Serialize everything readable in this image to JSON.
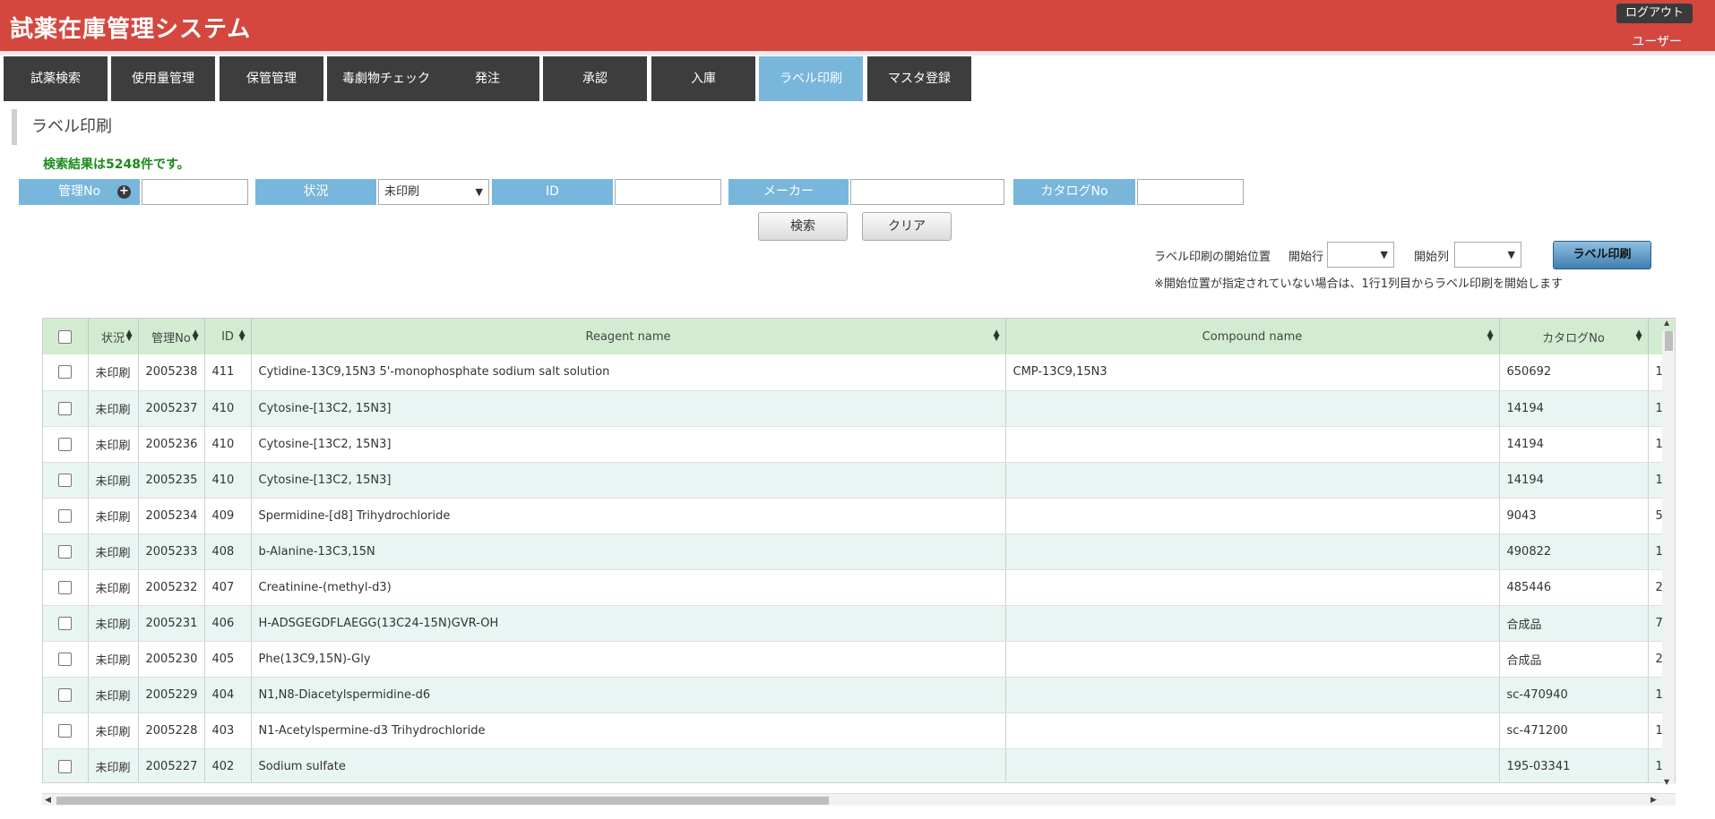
{
  "header": {
    "title": "試薬在庫管理システム",
    "logout": "ログアウト",
    "user": "ユーザー"
  },
  "nav": {
    "tabs": [
      {
        "label": "試薬検索"
      },
      {
        "label": "使用量管理"
      },
      {
        "label": "保管管理"
      },
      {
        "label": "毒劇物チェック"
      },
      {
        "label": "発注"
      },
      {
        "label": "承認"
      },
      {
        "label": "入庫"
      },
      {
        "label": "ラベル印刷",
        "active": true
      },
      {
        "label": "マスタ登録"
      }
    ]
  },
  "page": {
    "title": "ラベル印刷",
    "result_count": "検索結果は5248件です。"
  },
  "filters": {
    "kanri_no_label": "管理No",
    "kanri_no_value": "",
    "status_label": "状況",
    "status_value": "未印刷",
    "id_label": "ID",
    "id_value": "",
    "maker_label": "メーカー",
    "maker_value": "",
    "catalog_label": "カタログNo",
    "catalog_value": "",
    "search_button": "検索",
    "clear_button": "クリア"
  },
  "print_options": {
    "start_position_label": "ラベル印刷の開始位置",
    "start_row_label": "開始行",
    "start_row_value": "",
    "start_col_label": "開始列",
    "start_col_value": "",
    "print_button": "ラベル印刷",
    "note": "※開始位置が指定されていない場合は、1行1列目からラベル印刷を開始します"
  },
  "table": {
    "headers": {
      "status": "状況",
      "kanri_no": "管理No",
      "id": "ID",
      "reagent": "Reagent name",
      "compound": "Compound name",
      "catalog": "カタログNo"
    },
    "rows": [
      {
        "status": "未印刷",
        "kanri_no": "2005238",
        "id": "411",
        "reagent": "Cytidine-13C9,15N3 5'-monophosphate sodium salt solution",
        "compound": "CMP-13C9,15N3",
        "catalog": "650692",
        "extra": "1"
      },
      {
        "status": "未印刷",
        "kanri_no": "2005237",
        "id": "410",
        "reagent": "Cytosine-[13C2, 15N3]",
        "compound": "",
        "catalog": "14194",
        "extra": "1"
      },
      {
        "status": "未印刷",
        "kanri_no": "2005236",
        "id": "410",
        "reagent": "Cytosine-[13C2, 15N3]",
        "compound": "",
        "catalog": "14194",
        "extra": "1"
      },
      {
        "status": "未印刷",
        "kanri_no": "2005235",
        "id": "410",
        "reagent": "Cytosine-[13C2, 15N3]",
        "compound": "",
        "catalog": "14194",
        "extra": "1"
      },
      {
        "status": "未印刷",
        "kanri_no": "2005234",
        "id": "409",
        "reagent": "Spermidine-[d8] Trihydrochloride",
        "compound": "",
        "catalog": "9043",
        "extra": "5"
      },
      {
        "status": "未印刷",
        "kanri_no": "2005233",
        "id": "408",
        "reagent": "b-Alanine-13C3,15N",
        "compound": "",
        "catalog": "490822",
        "extra": "1"
      },
      {
        "status": "未印刷",
        "kanri_no": "2005232",
        "id": "407",
        "reagent": "Creatinine-(methyl-d3)",
        "compound": "",
        "catalog": "485446",
        "extra": "2"
      },
      {
        "status": "未印刷",
        "kanri_no": "2005231",
        "id": "406",
        "reagent": "H-ADSGEGDFLAEGG(13C24-15N)GVR-OH",
        "compound": "",
        "catalog": "合成品",
        "extra": "7"
      },
      {
        "status": "未印刷",
        "kanri_no": "2005230",
        "id": "405",
        "reagent": "Phe(13C9,15N)-Gly",
        "compound": "",
        "catalog": "合成品",
        "extra": "2"
      },
      {
        "status": "未印刷",
        "kanri_no": "2005229",
        "id": "404",
        "reagent": "N1,N8-Diacetylspermidine-d6",
        "compound": "",
        "catalog": "sc-470940",
        "extra": "1"
      },
      {
        "status": "未印刷",
        "kanri_no": "2005228",
        "id": "403",
        "reagent": "N1-Acetylspermine-d3 Trihydrochloride",
        "compound": "",
        "catalog": "sc-471200",
        "extra": "1"
      },
      {
        "status": "未印刷",
        "kanri_no": "2005227",
        "id": "402",
        "reagent": "Sodium sulfate",
        "compound": "",
        "catalog": "195-03341",
        "extra": "1"
      }
    ]
  }
}
